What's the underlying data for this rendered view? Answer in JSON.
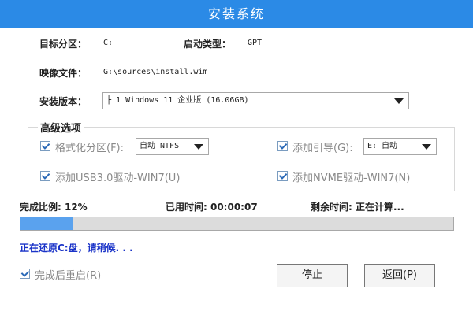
{
  "window": {
    "title": "安装系统"
  },
  "target_partition": {
    "label": "目标分区：",
    "value": "C:"
  },
  "boot_type": {
    "label": "启动类型：",
    "value": "GPT"
  },
  "image_file": {
    "label": "映像文件：",
    "value": "G:\\sources\\install.wim"
  },
  "install_version": {
    "label": "安装版本：",
    "value": "├ 1 Windows 11 企业版 (16.06GB)"
  },
  "advanced": {
    "title": "高级选项",
    "format_partition": {
      "label": "格式化分区(F):",
      "checked": true,
      "value": "自动 NTFS"
    },
    "add_boot": {
      "label": "添加引导(G):",
      "checked": true,
      "value": "E: 自动"
    },
    "usb3_driver": {
      "label": "添加USB3.0驱动-WIN7(U)",
      "checked": true
    },
    "nvme_driver": {
      "label": "添加NVME驱动-WIN7(N)",
      "checked": true
    }
  },
  "progress": {
    "ratio_text": "完成比例: 12%",
    "elapsed_text": "已用时间: 00:00:07",
    "remaining_text": "剩余时间: 正在计算...",
    "fraction": 0.12,
    "status": "正在还原C:盘，请稍候. . ."
  },
  "reboot_after": {
    "label": "完成后重启(R)",
    "checked": true
  },
  "buttons": {
    "stop": "停止",
    "back": "返回(P)"
  },
  "colors": {
    "title_bar": "#2b8ae6",
    "progress_fill": "#5aa2ee",
    "status_text": "#1a33c8"
  }
}
